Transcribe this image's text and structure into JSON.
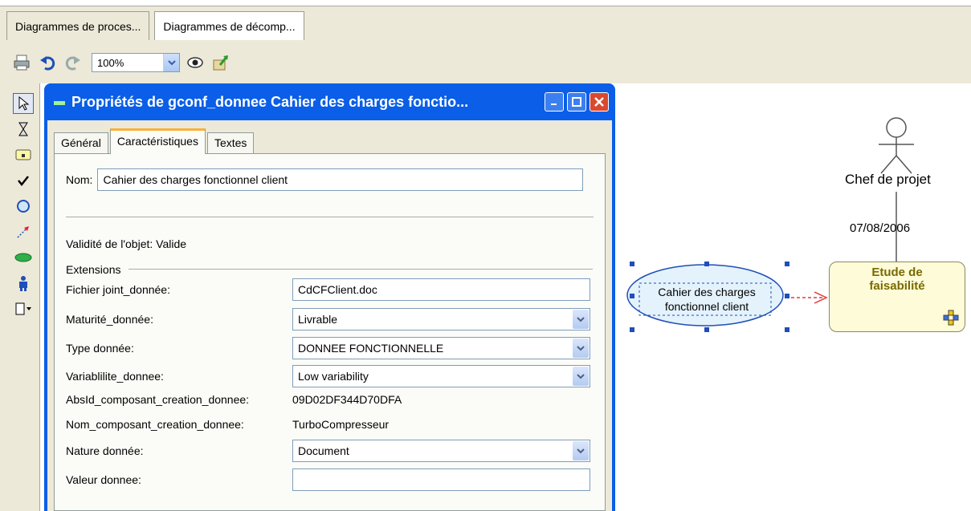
{
  "tabs": [
    {
      "label": "Diagrammes de proces..."
    },
    {
      "label": "Diagrammes de décomp..."
    }
  ],
  "toolbar": {
    "zoom": "100%"
  },
  "dialog": {
    "title": "Propriétés de gconf_donnee Cahier des charges fonctio...",
    "tabs": [
      "Général",
      "Caractéristiques",
      "Textes"
    ],
    "nom_label": "Nom:",
    "nom_value": "Cahier des charges fonctionnel client",
    "validite": "Validité de l'objet:  Valide",
    "extensions_label": "Extensions",
    "fields": [
      {
        "label": "Fichier joint_donnée:",
        "value": "CdCFClient.doc"
      },
      {
        "label": "Maturité_donnée:",
        "value": "Livrable"
      },
      {
        "label": "Type donnée:",
        "value": "DONNEE FONCTIONNELLE"
      },
      {
        "label": "Variablilite_donnee:",
        "value": "Low variability"
      },
      {
        "label": "AbsId_composant_creation_donnee:",
        "value": "09D02DF344D70DFA"
      },
      {
        "label": "Nom_composant_creation_donnee:",
        "value": "TurboCompresseur"
      },
      {
        "label": "Nature donnée:",
        "value": "Document"
      },
      {
        "label": "Valeur donnee:",
        "value": ""
      }
    ]
  },
  "diagram": {
    "actor_label": "Chef de projet",
    "date": "07/08/2006",
    "data_object": "Cahier des charges fonctionnel client",
    "activity": "Etude de faisabilité"
  }
}
